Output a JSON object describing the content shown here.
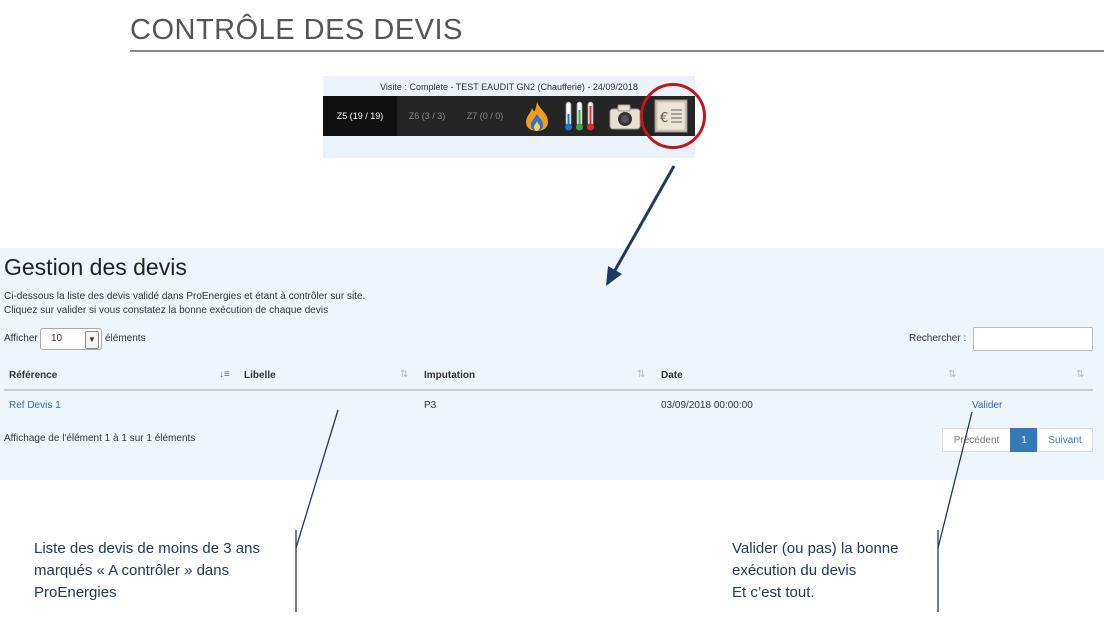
{
  "slide": {
    "title": "CONTRÔLE DES DEVIS"
  },
  "visit": {
    "caption": "Visite : Complète - TEST EAUDIT GN2 (Chaufferie) - 24/09/2018",
    "zones": [
      "Z5 (19 / 19)",
      "Z6 (3 / 3)",
      "Z7 (0 / 0)"
    ],
    "tools": [
      "flame-icon",
      "thermometers-icon",
      "camera-icon",
      "quote-document-icon"
    ]
  },
  "panel": {
    "title": "Gestion des devis",
    "intro_line1": "Ci-dessous la liste des devis validé dans ProEnergies et étant à contrôler sur site.",
    "intro_line2": "Cliquez sur valider si vous constatez la bonne exécution de chaque devis",
    "show_label": "Afficher",
    "show_value": "10",
    "show_suffix": "éléments",
    "search_label": "Rechercher :",
    "columns": [
      "Référence",
      "Libelle",
      "Imputation",
      "Date"
    ],
    "row": {
      "reference": "Ref Devis 1",
      "libelle": "",
      "imputation": "P3",
      "date": "03/09/2018 00:00:00",
      "action": "Valider"
    },
    "info": "Affichage de l'élément 1 à 1 sur 1 éléments",
    "pagination": {
      "prev": "Précédent",
      "current": "1",
      "next": "Suivant"
    }
  },
  "callouts": {
    "left_line1": "Liste des devis de moins de 3 ans",
    "left_line2": "marqués « A contrôler » dans",
    "left_line3": "ProEnergies",
    "right_line1": "Valider (ou pas) la bonne",
    "right_line2": "exécution du devis",
    "right_line3": "Et c’est tout."
  },
  "colors": {
    "accent": "#337ab7",
    "highlight": "#c0171d",
    "callout_text": "#1f3864"
  }
}
